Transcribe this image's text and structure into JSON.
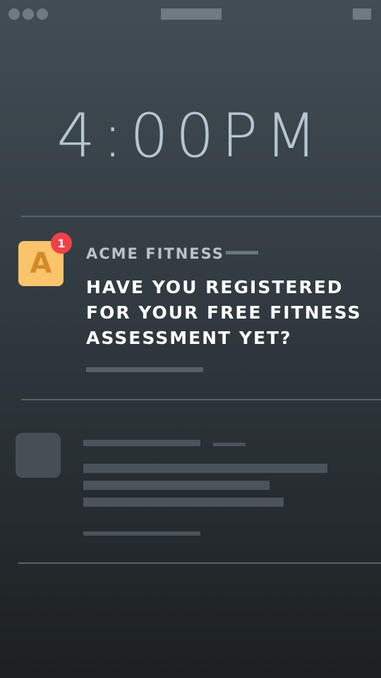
{
  "clock": {
    "time": "4:00PM"
  },
  "notification": {
    "app_name": "ACME FITNESS",
    "app_icon_letter": "A",
    "badge_count": "1",
    "message": "HAVE YOU REGISTERED FOR YOUR FREE FITNESS ASSESSMENT YET?"
  },
  "colors": {
    "app_icon_bg": "#f9c46b",
    "app_icon_letter": "#d58a27",
    "badge_bg": "#f0414b",
    "clock_text": "#b5c6d0"
  },
  "icons": [
    "window-dots-icon",
    "app-icon",
    "notification-badge"
  ]
}
